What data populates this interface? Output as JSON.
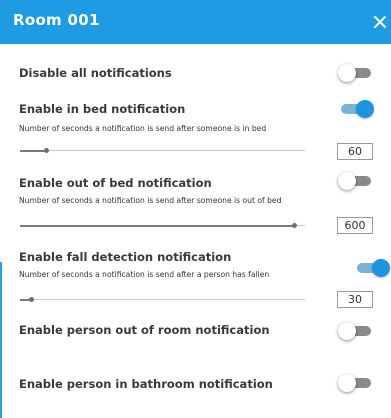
{
  "header": {
    "title": "Room 001",
    "accent_color": "#1e9be3"
  },
  "settings": [
    {
      "label": "Disable all notifications",
      "enabled": false
    },
    {
      "label": "Enable in bed notification",
      "enabled": true,
      "description": "Number of seconds a notification is send after someone is in bed",
      "value": "60",
      "slider_fraction": 0.09
    },
    {
      "label": "Enable out of bed notification",
      "enabled": false,
      "description": "Number of seconds a notification is send after someone is out of bed",
      "value": "600",
      "slider_fraction": 0.96
    },
    {
      "label": "Enable fall detection notification",
      "enabled": true,
      "description": "Number of seconds a notification is send after a person has fallen",
      "value": "30",
      "slider_fraction": 0.04
    },
    {
      "label": "Enable person out of room notification",
      "enabled": false
    },
    {
      "label": "Enable person in bathroom notification",
      "enabled": false
    }
  ]
}
